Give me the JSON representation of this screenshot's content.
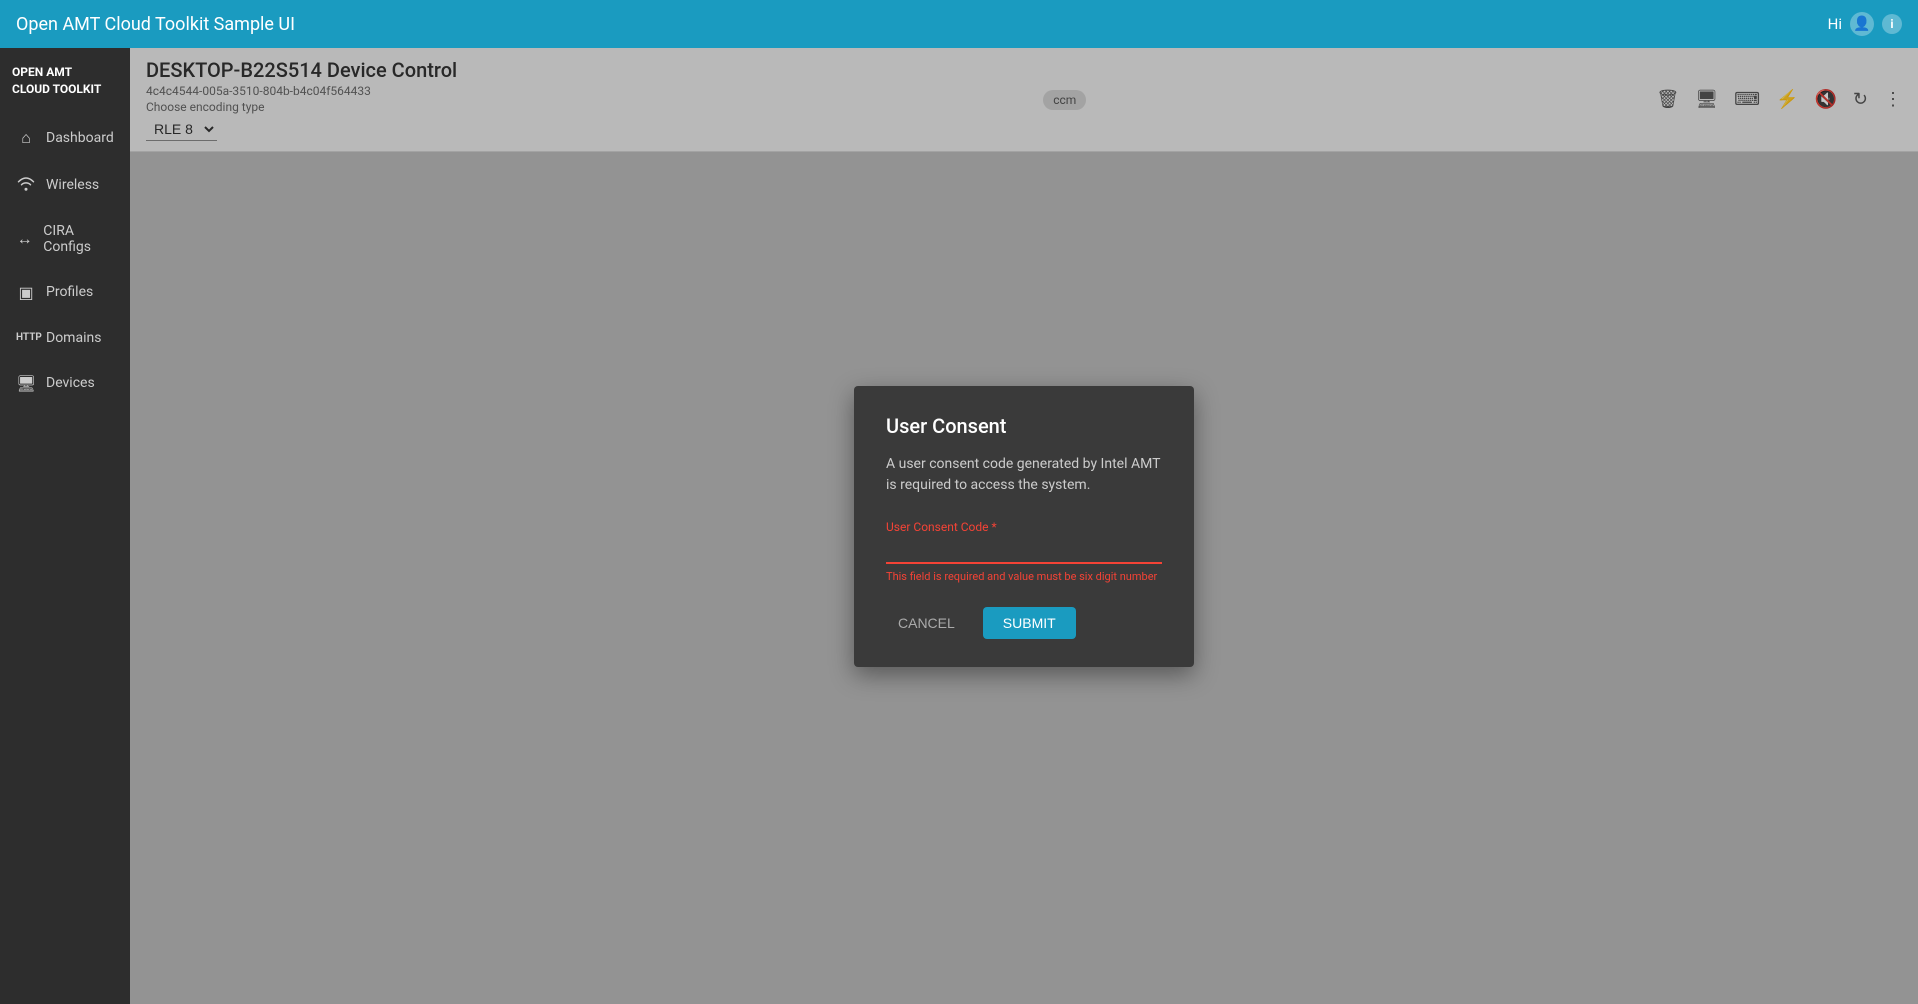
{
  "app": {
    "title": "Open AMT Cloud Toolkit Sample UI",
    "brand": "OPEN AMT\nCLOUD TOOLKIT",
    "hi_label": "Hi",
    "brand_line1": "OPEN AMT",
    "brand_line2": "CLOUD TOOLKIT"
  },
  "sidebar": {
    "items": [
      {
        "id": "dashboard",
        "label": "Dashboard",
        "icon": "🏠"
      },
      {
        "id": "wireless",
        "label": "Wireless",
        "icon": "📶"
      },
      {
        "id": "cira-configs",
        "label": "CIRA Configs",
        "icon": "↔"
      },
      {
        "id": "profiles",
        "label": "Profiles",
        "icon": "🖼"
      },
      {
        "id": "domains",
        "label": "Domains",
        "icon": "HTTP"
      },
      {
        "id": "devices",
        "label": "Devices",
        "icon": "🖥"
      }
    ]
  },
  "device": {
    "title": "DESKTOP-B22S514 Device Control",
    "id": "4c4c4544-005a-3510-804b-b4c04f564433",
    "encoding_label": "Choose encoding type",
    "encoding_value": "RLE 8",
    "badge": "ccm"
  },
  "toolbar": {
    "delete_label": "delete",
    "monitor_label": "monitor",
    "keyboard_label": "keyboard",
    "power_label": "power",
    "volume_mute_label": "volume_mute",
    "refresh_label": "refresh",
    "more_label": "more_vert"
  },
  "dialog": {
    "title": "User Consent",
    "description": "A user consent code generated by Intel AMT is required to access the system.",
    "field_label": "User Consent Code *",
    "error_message": "This field is required and value must be six digit number",
    "cancel_label": "Cancel",
    "submit_label": "Submit",
    "input_value": ""
  }
}
